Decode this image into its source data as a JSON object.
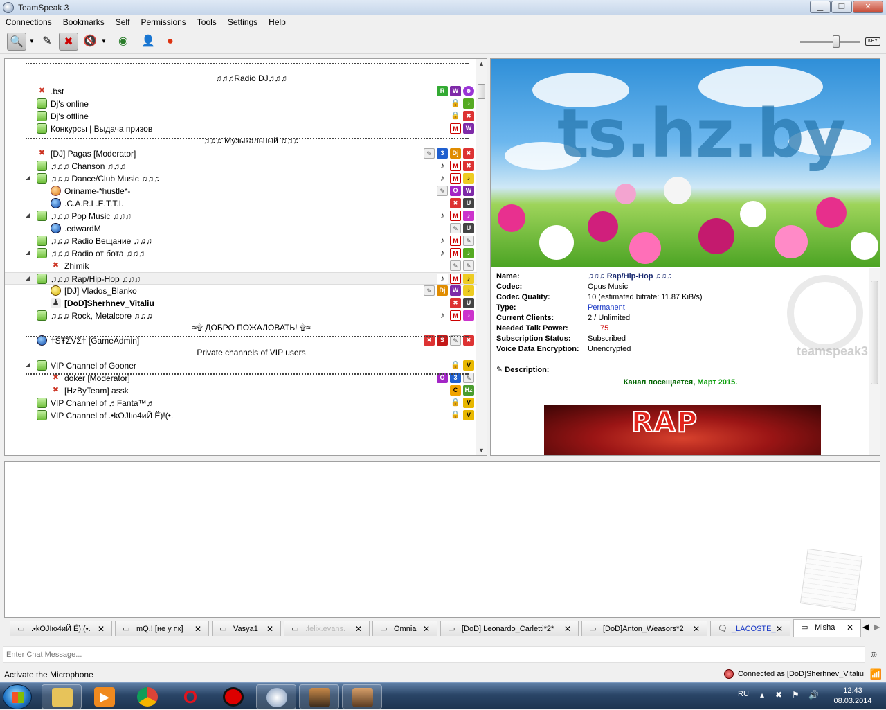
{
  "window": {
    "title": "TeamSpeak 3",
    "controls": {
      "minimize": "▁",
      "maximize": "❐",
      "close": "✕"
    }
  },
  "menu": [
    "Connections",
    "Bookmarks",
    "Self",
    "Permissions",
    "Tools",
    "Settings",
    "Help"
  ],
  "toolbar": {
    "icons": [
      "connect-icon",
      "away-icon",
      "mute-microphone-icon",
      "mute-speakers-icon",
      "screenshot-icon",
      "user-status-icon",
      "whisper-icon"
    ],
    "volume_icon": "speaker-icon",
    "hotkey_label": "KEY",
    "volume_level": 0.6
  },
  "tree": {
    "rows": [
      {
        "kind": "spacer",
        "text": "♫♫♫Radio DJ♫♫♫"
      },
      {
        "kind": "channel",
        "indent": 0,
        "icon": "spk",
        "text": ".bst",
        "badges": [
          "R",
          "W",
          "purple"
        ]
      },
      {
        "kind": "channel",
        "indent": 0,
        "icon": "ch",
        "text": "Dj's online",
        "badges": [
          "lock",
          "gn"
        ]
      },
      {
        "kind": "channel",
        "indent": 0,
        "icon": "ch",
        "text": "Dj's offline",
        "badges": [
          "lock",
          "rd"
        ]
      },
      {
        "kind": "channel",
        "indent": 0,
        "icon": "ch",
        "text": "Конкурсы | Выдача призов",
        "badges": [
          "M",
          "W"
        ]
      },
      {
        "kind": "spacer",
        "text": "♫♫♫ Музыкальный ♫♫♫"
      },
      {
        "kind": "channel",
        "indent": 0,
        "icon": "spk",
        "text": "[DJ] Pagas [Moderator]",
        "badges": [
          "gray",
          "b3",
          "D",
          "rd"
        ]
      },
      {
        "kind": "channel",
        "indent": 0,
        "icon": "ch",
        "text": "♫♫♫  Chanson ♫♫♫",
        "badges": [
          "note",
          "M",
          "rd"
        ]
      },
      {
        "kind": "channel",
        "indent": 0,
        "icon": "ch",
        "expander": true,
        "text": "♫♫♫  Dance/Club Music ♫♫♫",
        "badges": [
          "note",
          "M",
          "ye"
        ]
      },
      {
        "kind": "client",
        "indent": 1,
        "icon": "orange",
        "text": "Oriname-*hustle*-",
        "badges": [
          "gray",
          "O",
          "W"
        ]
      },
      {
        "kind": "client",
        "indent": 1,
        "icon": "blue",
        "text": ".C.A.R.L.E.T.T.I.",
        "badges": [
          "rd",
          "U"
        ]
      },
      {
        "kind": "channel",
        "indent": 0,
        "icon": "ch",
        "expander": true,
        "text": "♫♫♫  Pop Music ♫♫♫",
        "badges": [
          "note",
          "M",
          "pk"
        ]
      },
      {
        "kind": "client",
        "indent": 1,
        "icon": "blue",
        "text": ".edwardM",
        "badges": [
          "gray",
          "U"
        ]
      },
      {
        "kind": "channel",
        "indent": 0,
        "icon": "ch",
        "text": "♫♫♫  Radio Вещание ♫♫♫",
        "badges": [
          "note",
          "M",
          "gray"
        ]
      },
      {
        "kind": "channel",
        "indent": 0,
        "icon": "ch",
        "expander": true,
        "text": "♫♫♫  Radio от бота ♫♫♫",
        "badges": [
          "note",
          "M",
          "gn"
        ]
      },
      {
        "kind": "client",
        "indent": 1,
        "icon": "spk",
        "text": "Zhimik",
        "badges": [
          "gray",
          "gray"
        ]
      },
      {
        "kind": "channel",
        "indent": 0,
        "icon": "ch",
        "expander": true,
        "selected": true,
        "text": "♫♫♫  Rap/Hip-Hop ♫♫♫",
        "badges": [
          "note",
          "M",
          "ye"
        ]
      },
      {
        "kind": "client",
        "indent": 1,
        "icon": "yellow",
        "text": "[DJ] Vlados_Blanko",
        "badges": [
          "gray",
          "D",
          "W",
          "ye"
        ]
      },
      {
        "kind": "client",
        "indent": 1,
        "icon": "user",
        "bold": true,
        "text": "[DoD]Sherhnev_Vitaliu",
        "badges": [
          "rd",
          "U"
        ]
      },
      {
        "kind": "channel",
        "indent": 0,
        "icon": "ch",
        "text": "♫♫♫  Rock, Metalcore ♫♫♫",
        "badges": [
          "note",
          "M",
          "pk"
        ]
      },
      {
        "kind": "spacer",
        "text": "≈۩ ДОБРО ПОЖАЛОВАТЬ! ۩≈"
      },
      {
        "kind": "channel",
        "indent": 0,
        "icon": "blue",
        "text": "†ŠŦΣVΣ† [GameAdmin]",
        "badges": [
          "rd",
          "S",
          "gray",
          "rd"
        ]
      },
      {
        "kind": "spacer",
        "text": "Private channels of VIP users"
      },
      {
        "kind": "channel",
        "indent": 0,
        "icon": "ch",
        "expander": true,
        "text": "VIP Channel of Gooner",
        "badges": [
          "lock",
          "V"
        ]
      },
      {
        "kind": "client",
        "indent": 1,
        "icon": "spk",
        "text": "doker [Moderator]",
        "badges": [
          "O",
          "b3",
          "gray"
        ]
      },
      {
        "kind": "client",
        "indent": 1,
        "icon": "spk",
        "text": "[HzByTeam] assk",
        "badges": [
          "C",
          "H"
        ]
      },
      {
        "kind": "channel",
        "indent": 0,
        "icon": "ch",
        "text": "VIP Channel of ♬Fanta™♬",
        "badges": [
          "lock",
          "V"
        ]
      },
      {
        "kind": "channel",
        "indent": 0,
        "icon": "ch",
        "text": "VIP Channel of .•kOJIю4иЙ Ё)!(•.",
        "badges": [
          "lock",
          "V"
        ]
      }
    ]
  },
  "info": {
    "banner_text": "ts.hz.by",
    "fields": [
      {
        "key": "Name:",
        "value": "♫♫♫  Rap/Hip-Hop ♫♫♫",
        "style": "bold"
      },
      {
        "key": "Codec:",
        "value": "Opus Music"
      },
      {
        "key": "Codec Quality:",
        "value": "10 (estimated bitrate: 11.87 KiB/s)"
      },
      {
        "key": "Type:",
        "value": "Permanent",
        "style": "link"
      },
      {
        "key": "Current Clients:",
        "value": "2 / Unlimited"
      },
      {
        "key": "Needed Talk Power:",
        "value": "75",
        "style": "red"
      },
      {
        "key": "Subscription Status:",
        "value": "Subscribed"
      },
      {
        "key": "Voice Data Encryption:",
        "value": "Unencrypted"
      }
    ],
    "description_label": "Description:",
    "description_text": "Канал посещается, ",
    "description_highlight": "Март 2015.",
    "rap_image_text": "RAP",
    "watermark_text": "teamspeak3"
  },
  "chat": {
    "tabs": [
      {
        "label": ".•kOJIю4иЙ Ё)!(•.",
        "style": "normal"
      },
      {
        "label": "mQ.! [не у пк]",
        "style": "normal"
      },
      {
        "label": "Vasya1",
        "style": "normal"
      },
      {
        "label": ".felix.evans.",
        "style": "faded"
      },
      {
        "label": "Omnia",
        "style": "normal"
      },
      {
        "label": "[DoD] Leonardo_Carletti*2*",
        "style": "normal"
      },
      {
        "label": "[DoD]Anton_Weasors*2",
        "style": "normal"
      },
      {
        "label": "_LACOSTE_",
        "style": "blue"
      },
      {
        "label": "Misha",
        "style": "active"
      }
    ],
    "tab_close": "✕",
    "input_placeholder": "Enter Chat Message..."
  },
  "status": {
    "left": "Activate the Microphone",
    "right": "Connected as [DoD]Sherhnev_Vitaliu"
  },
  "taskbar": {
    "apps": [
      "explorer-icon",
      "media-player-icon",
      "chrome-icon",
      "opera-icon",
      "recorder-icon",
      "teamspeak-icon",
      "game-icon-1",
      "game-icon-2"
    ],
    "language": "RU",
    "time": "12:43",
    "date": "08.03.2014"
  },
  "colors": {
    "accent_blue": "#1a39c6",
    "channel_green": "#6fbf3a",
    "close_red": "#c74a35"
  }
}
